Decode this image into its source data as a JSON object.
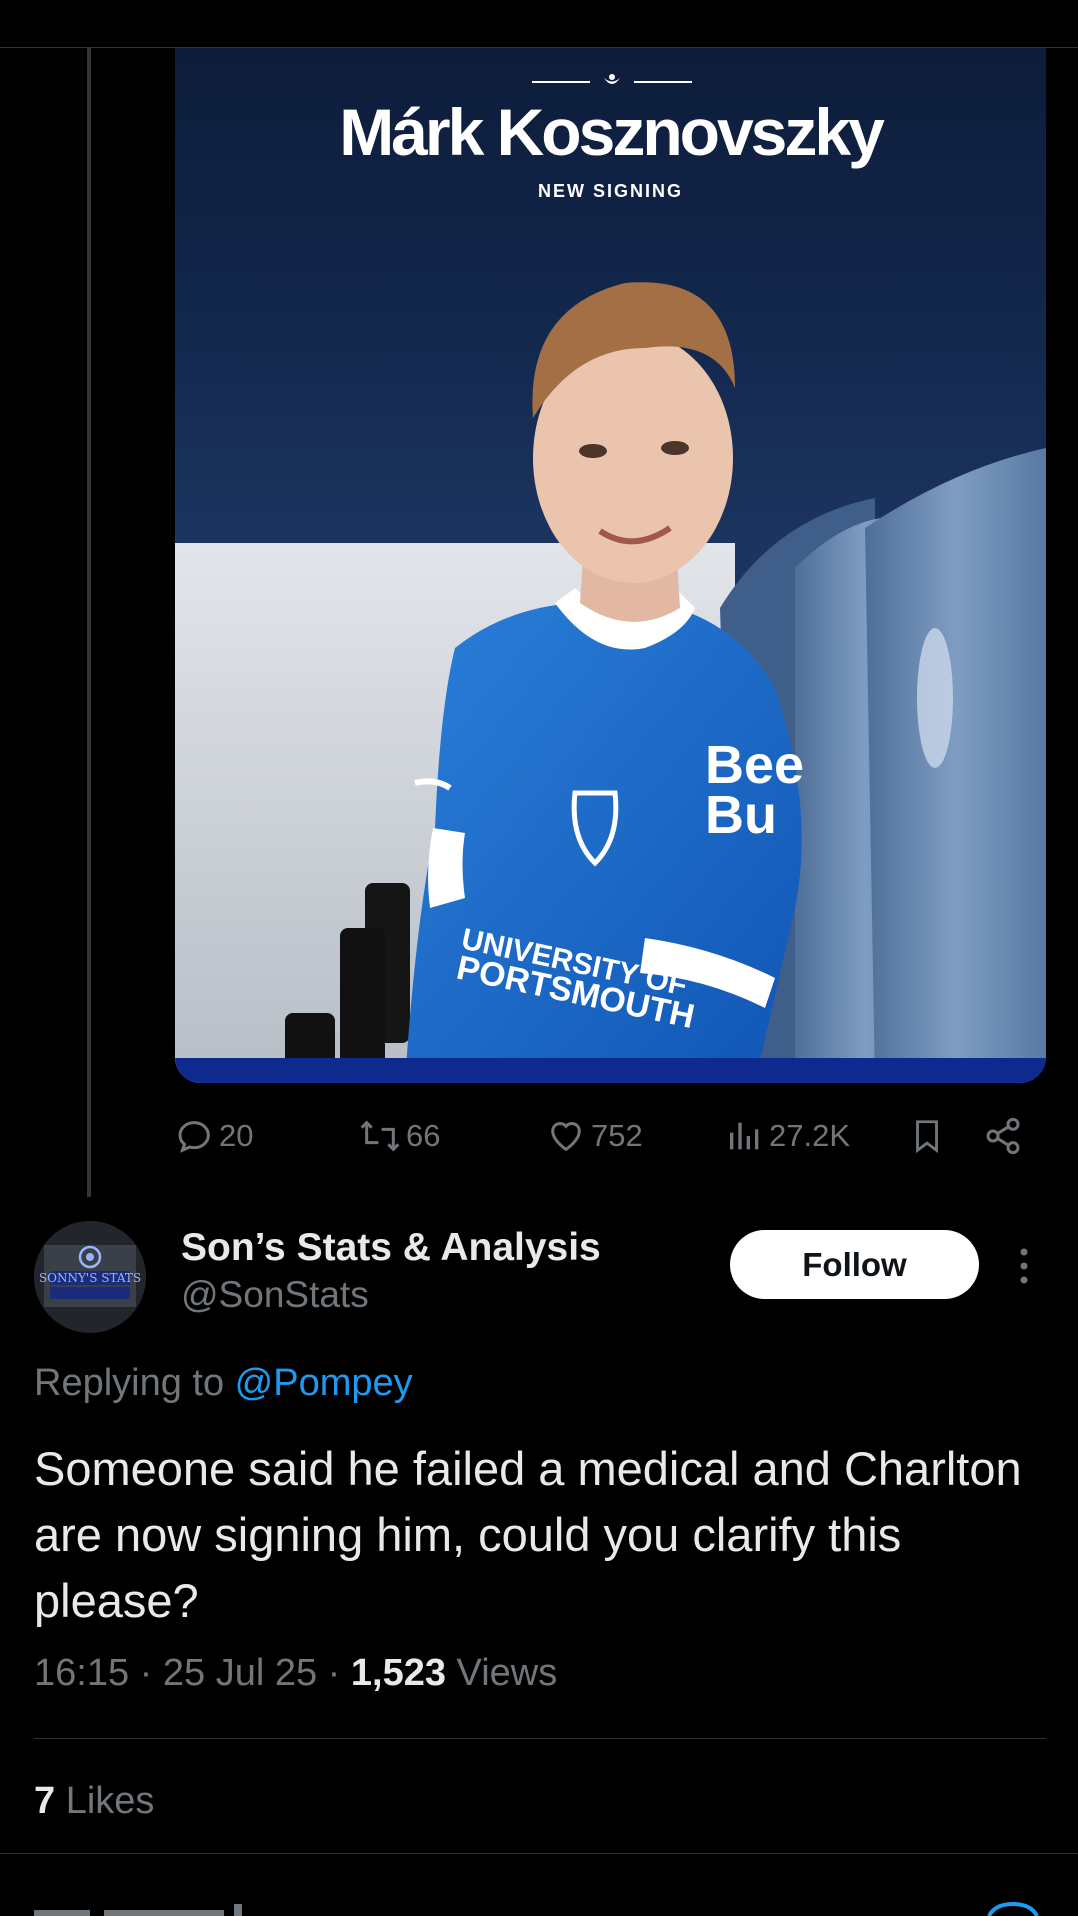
{
  "colors": {
    "background": "#000000",
    "primary_text": "#e7e9ea",
    "secondary_text": "#71767b",
    "link": "#1d9bf0",
    "divider": "#2f3336"
  },
  "media": {
    "title": "Márk Kosznovszky",
    "subtitle": "NEW SIGNING",
    "shirt_sponsor": "Bee Bu",
    "shirt_text": "UNIVERSITY OF PORTSMOUTH"
  },
  "actions": {
    "reply": {
      "icon": "reply-icon",
      "count": "20"
    },
    "repost": {
      "icon": "repost-icon",
      "count": "66"
    },
    "like": {
      "icon": "heart-icon",
      "count": "752"
    },
    "views": {
      "icon": "views-icon",
      "count": "27.2K"
    },
    "bookmark": {
      "icon": "bookmark-icon"
    },
    "share": {
      "icon": "share-icon"
    }
  },
  "reply_tweet": {
    "author_name": "Son’s Stats & Analysis",
    "author_handle": "@SonStats",
    "avatar_text": "SONNY'S STATS",
    "follow_label": "Follow",
    "replying_prefix": "Replying to ",
    "replying_mention": "@Pompey",
    "text": "Someone said he failed a medical and Charlton are now signing him, could you clarify this please?",
    "time": "16:15",
    "date": "25 Jul 25",
    "views_count": "1,523",
    "views_label": " Views",
    "likes_count": "7",
    "likes_label": " Likes"
  }
}
